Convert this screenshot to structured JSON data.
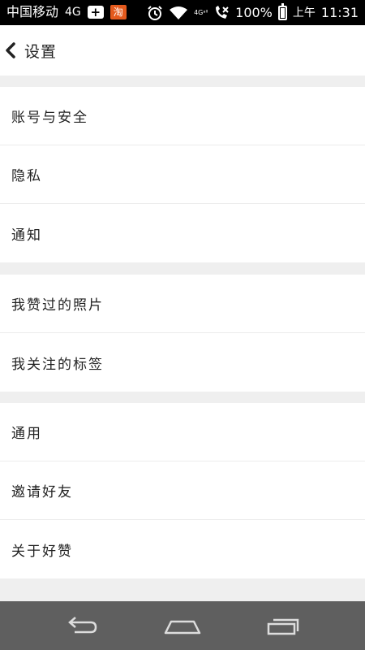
{
  "status_bar": {
    "carrier": "中国移动",
    "network": "4G",
    "taobao_glyph": "淘",
    "signal_label": "4Gᵃˡˡ",
    "battery": "100%",
    "battery_level": 1.0,
    "time_period": "上午",
    "time": "11:31"
  },
  "header": {
    "title": "设置"
  },
  "groups": [
    {
      "items": [
        {
          "label": "账号与安全"
        },
        {
          "label": "隐私"
        },
        {
          "label": "通知"
        }
      ]
    },
    {
      "items": [
        {
          "label": "我赞过的照片"
        },
        {
          "label": "我关注的标签"
        }
      ]
    },
    {
      "items": [
        {
          "label": "通用"
        },
        {
          "label": "邀请好友"
        },
        {
          "label": "关于好赞"
        }
      ]
    }
  ],
  "icons": {
    "back": "chevron-left-icon",
    "nav_back": "back-arrow-icon",
    "nav_home": "home-icon",
    "nav_recents": "recent-apps-icon"
  },
  "colors": {
    "status_bar_bg": "#000000",
    "page_bg": "#efefef",
    "row_bg": "#ffffff",
    "nav_bar_bg": "#5f5f5f",
    "taobao_badge": "#e45a1d"
  }
}
